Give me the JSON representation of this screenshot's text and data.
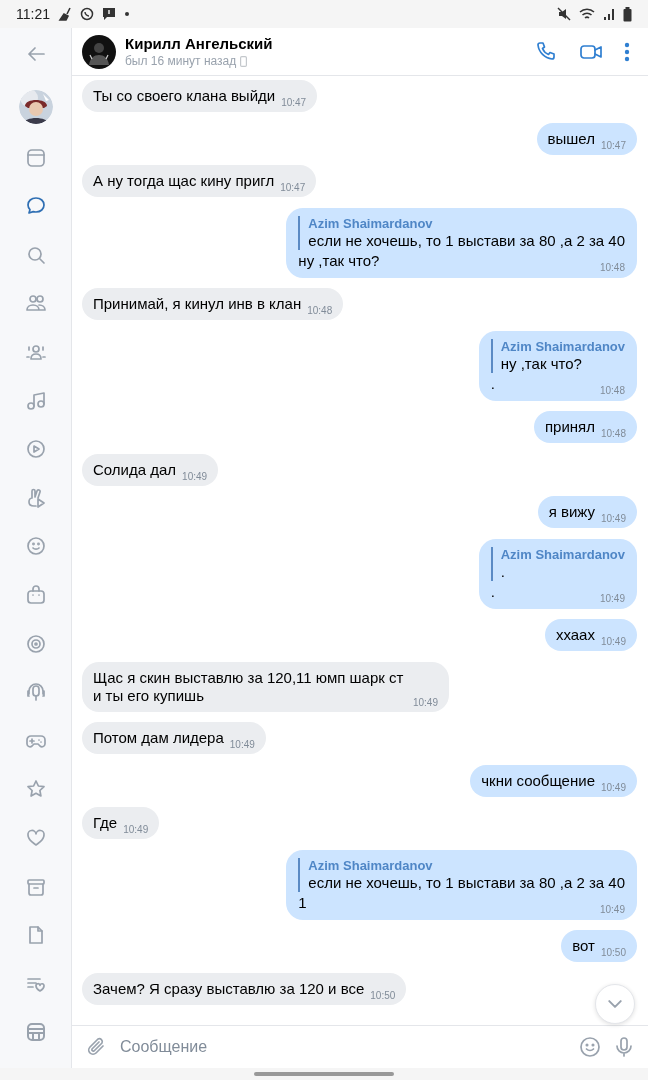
{
  "status_bar": {
    "time": "11:21"
  },
  "rail": {
    "items": [
      {
        "kind": "window",
        "selected": false
      },
      {
        "kind": "chat",
        "selected": true
      },
      {
        "kind": "search",
        "selected": false
      },
      {
        "kind": "friends",
        "selected": false
      },
      {
        "kind": "communities",
        "selected": false
      },
      {
        "kind": "music",
        "selected": false
      },
      {
        "kind": "video",
        "selected": false
      },
      {
        "kind": "clips",
        "selected": false
      },
      {
        "kind": "smile",
        "selected": false
      },
      {
        "kind": "bag",
        "selected": false
      },
      {
        "kind": "target",
        "selected": false
      },
      {
        "kind": "podcast",
        "selected": false
      },
      {
        "kind": "gamepad",
        "selected": false
      },
      {
        "kind": "star",
        "selected": false
      },
      {
        "kind": "heart",
        "selected": false
      },
      {
        "kind": "archive",
        "selected": false
      },
      {
        "kind": "document",
        "selected": false
      },
      {
        "kind": "liked-list",
        "selected": false
      },
      {
        "kind": "panel",
        "selected": false
      }
    ]
  },
  "header": {
    "name": "Кирилл Ангельский",
    "last_seen": "был 16 минут назад"
  },
  "messages": [
    {
      "kind": "incoming",
      "text": "Ты со своего клана выйди",
      "time": "10:47"
    },
    {
      "kind": "outgoing",
      "text": "вышел",
      "time": "10:47"
    },
    {
      "kind": "incoming",
      "text": "А ну тогда щас кину пригл",
      "time": "10:47"
    },
    {
      "kind": "outgoing",
      "reply": {
        "author": "Azim Shaimardanov",
        "text": "если не хочешь, то 1 выстави за 80 ,а 2 за 40"
      },
      "text": "ну ,так что?",
      "time": "10:48"
    },
    {
      "kind": "incoming",
      "text": "Принимай, я кинул инв в клан",
      "time": "10:48"
    },
    {
      "kind": "outgoing",
      "reply": {
        "author": "Azim Shaimardanov",
        "text": "ну ,так что?"
      },
      "text": ".",
      "time": "10:48"
    },
    {
      "kind": "outgoing",
      "text": "принял",
      "time": "10:48"
    },
    {
      "kind": "incoming",
      "text": "Солида дал",
      "time": "10:49"
    },
    {
      "kind": "outgoing",
      "text": "я вижу",
      "time": "10:49"
    },
    {
      "kind": "outgoing",
      "reply": {
        "author": "Azim Shaimardanov",
        "text": "."
      },
      "text": ".",
      "time": "10:49"
    },
    {
      "kind": "outgoing",
      "text": "ххаах",
      "time": "10:49"
    },
    {
      "kind": "incoming",
      "text": "Щас я скин выставлю за 120,11 юмп шарк ст и ты его купишь",
      "time": "10:49"
    },
    {
      "kind": "incoming",
      "text": "Потом дам лидера",
      "time": "10:49"
    },
    {
      "kind": "outgoing",
      "text": "чкни сообщение",
      "time": "10:49"
    },
    {
      "kind": "incoming",
      "text": "Где",
      "time": "10:49"
    },
    {
      "kind": "outgoing",
      "reply": {
        "author": "Azim Shaimardanov",
        "text": "если не хочешь, то 1 выстави за 80 ,а 2 за 40"
      },
      "text": "1",
      "time": "10:49"
    },
    {
      "kind": "outgoing",
      "text": "вот",
      "time": "10:50"
    },
    {
      "kind": "incoming",
      "text": "Зачем? Я сразу выставлю за 120 и все",
      "time": "10:50"
    }
  ],
  "composer": {
    "placeholder": "Сообщение"
  }
}
